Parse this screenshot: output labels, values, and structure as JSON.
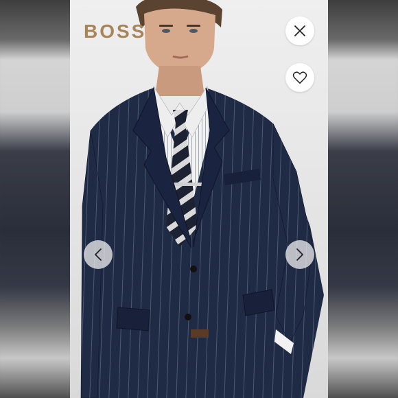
{
  "brand": {
    "logo_text": "BOSS",
    "color": "#a8845b"
  },
  "controls": {
    "close": {
      "icon": "close-icon"
    },
    "favorite": {
      "icon": "heart-icon"
    },
    "previous": {
      "icon": "chevron-left-icon"
    },
    "next": {
      "icon": "chevron-right-icon"
    }
  },
  "photo": {
    "subject": "model-in-navy-pinstripe-suit",
    "suit_color": "#1f2a44",
    "tie_colors": [
      "#1d2233",
      "#d9d9d9"
    ]
  }
}
